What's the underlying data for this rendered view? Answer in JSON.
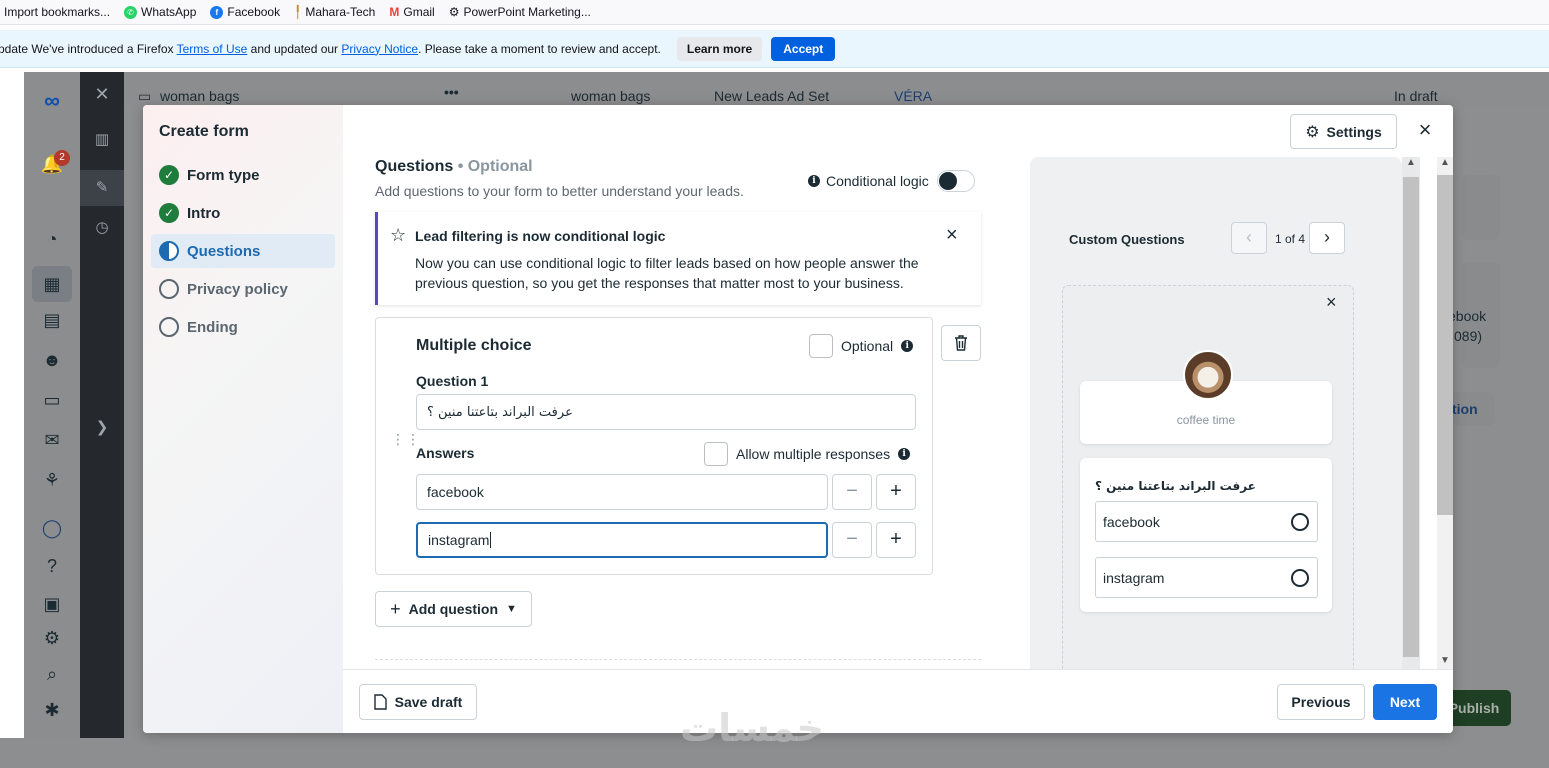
{
  "bookmarks": [
    {
      "label": "Import bookmarks...",
      "icon": "import-icon",
      "color": "#6b6b6b"
    },
    {
      "label": "WhatsApp",
      "icon": "whatsapp-icon",
      "color": "#25d366"
    },
    {
      "label": "Facebook",
      "icon": "facebook-icon",
      "color": "#1877f2"
    },
    {
      "label": "Mahara-Tech",
      "icon": "mahara-icon",
      "color": "#c98a2b"
    },
    {
      "label": "Gmail",
      "icon": "gmail-icon",
      "color": "#ea4335"
    },
    {
      "label": "PowerPoint Marketing...",
      "icon": "openai-icon",
      "color": "#333333"
    }
  ],
  "notification": {
    "text_before": "pdate We've introduced a Firefox ",
    "terms_link": "Terms of Use",
    "text_mid": " and updated our ",
    "privacy_link": "Privacy Notice",
    "text_after": ". Please take a moment to review and accept.",
    "learn_more": "Learn more",
    "accept": "Accept"
  },
  "background": {
    "account": "woman bags",
    "breadcrumb": [
      "woman bags",
      "New Leads Ad Set",
      "VÉRA"
    ],
    "status": "In draft",
    "side_text_1": "ebook",
    "side_text_2": "089)",
    "side_text_3": "tion",
    "publish": "Publish",
    "notif_count": "2"
  },
  "modal": {
    "title": "Create form",
    "steps": [
      {
        "label": "Form type",
        "state": "done"
      },
      {
        "label": "Intro",
        "state": "done"
      },
      {
        "label": "Questions",
        "state": "active"
      },
      {
        "label": "Privacy policy",
        "state": "todo"
      },
      {
        "label": "Ending",
        "state": "todo"
      }
    ],
    "settings": "Settings",
    "questions_title": "Questions",
    "questions_optional": "• Optional",
    "questions_sub": "Add questions to your form to better understand your leads.",
    "conditional_logic": "Conditional logic",
    "banner": {
      "title": "Lead filtering is now conditional logic",
      "body": "Now you can use conditional logic to filter leads based on how people answer the previous question, so you get the responses that matter most to your business."
    },
    "question_card": {
      "type": "Multiple choice",
      "optional_label": "Optional",
      "question_label": "Question 1",
      "question_value": "عرفت البراند بتاعتنا منين ؟",
      "answers_label": "Answers",
      "allow_multiple": "Allow multiple responses",
      "answers": [
        "facebook",
        "instagram"
      ]
    },
    "add_question": "Add question",
    "save_draft": "Save draft",
    "previous": "Previous",
    "next": "Next"
  },
  "preview": {
    "title": "Custom Questions",
    "counter": "1 of 4",
    "page_name": "coffee time",
    "question": "عرفت البراند بتاعتنا منين ؟",
    "answers": [
      "facebook",
      "instagram"
    ]
  },
  "watermark": "خمسات",
  "colors": {
    "accent": "#1b74e4",
    "banner_accent": "#5e46c0",
    "done_green": "#1e7c3c"
  }
}
